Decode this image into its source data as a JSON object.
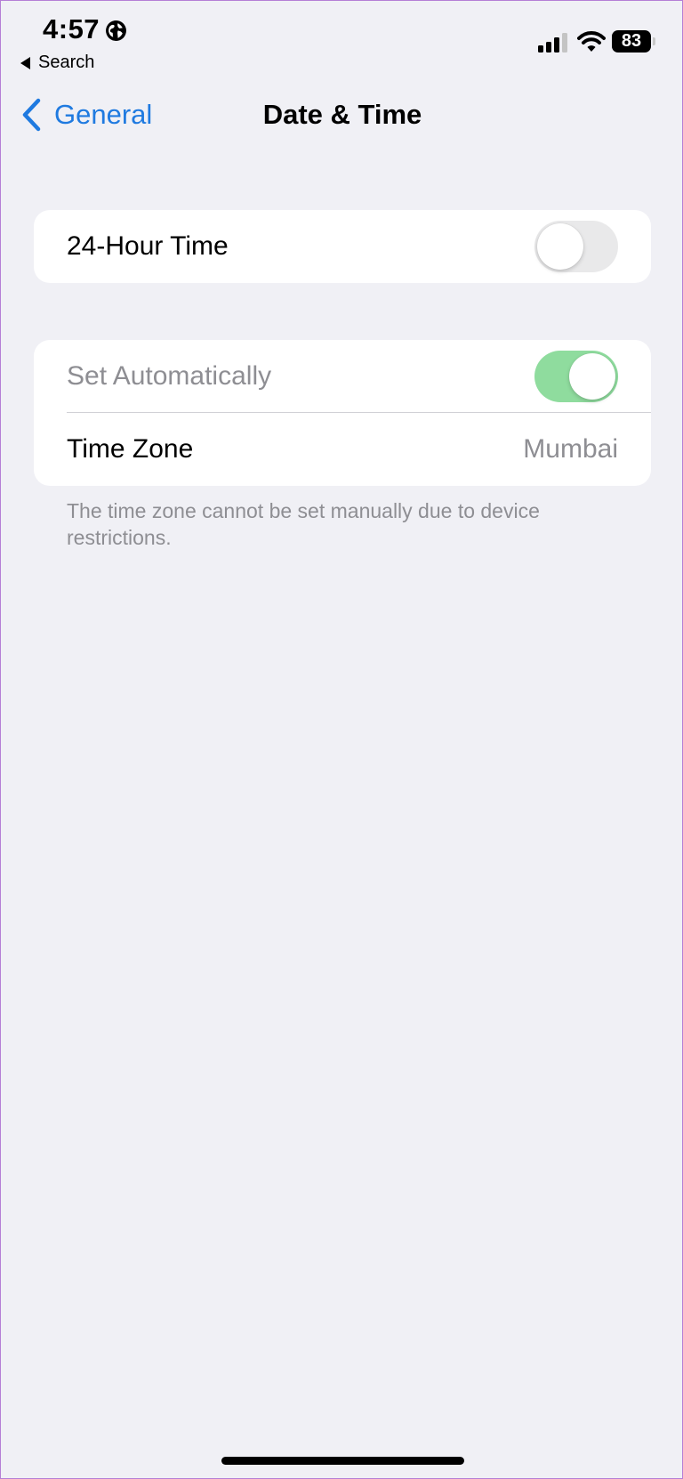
{
  "status_bar": {
    "time": "4:57",
    "back_app_label": "Search",
    "battery_level": "83",
    "icons": [
      "globe-icon",
      "signal-icon",
      "wifi-icon",
      "battery-icon"
    ]
  },
  "nav": {
    "back_label": "General",
    "title": "Date & Time",
    "accent_color": "#1f7ae0"
  },
  "settings": {
    "hour24": {
      "label": "24-Hour Time",
      "enabled": false
    },
    "set_automatically": {
      "label": "Set Automatically",
      "enabled": true,
      "disabled_control": true
    },
    "time_zone": {
      "label": "Time Zone",
      "value": "Mumbai"
    },
    "footnote": "The time zone cannot be set manually due to device restrictions."
  },
  "colors": {
    "background": "#f0f0f5",
    "toggle_on": "#8fdc9e",
    "toggle_off": "#e9e9ea",
    "secondary_text": "#8e8e93"
  }
}
